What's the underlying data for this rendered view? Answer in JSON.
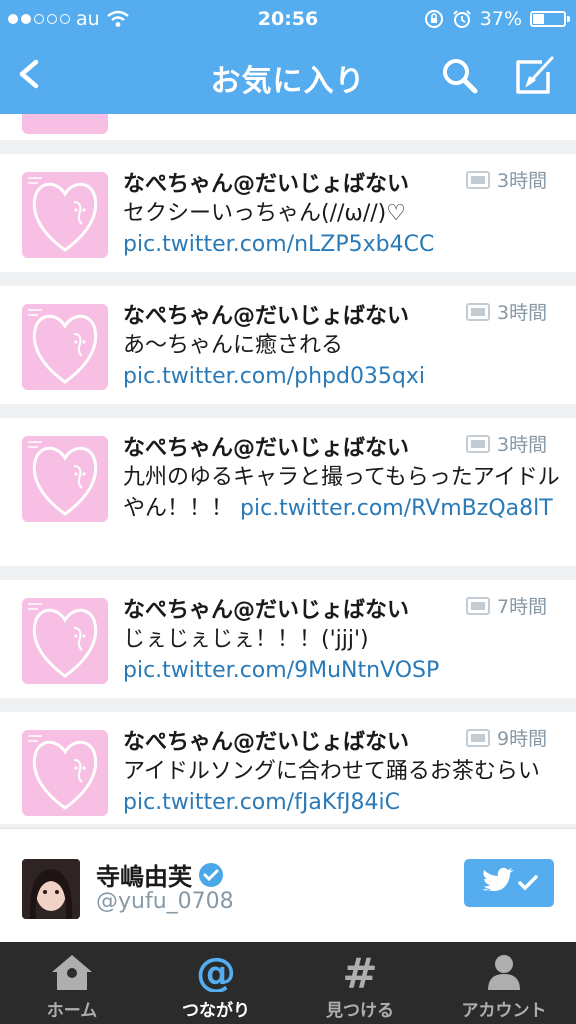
{
  "status": {
    "carrier": "au",
    "time": "20:56",
    "battery": "37%",
    "battery_level": 0.37
  },
  "nav": {
    "title": "お気に入り"
  },
  "tweets": [
    {
      "name": "なぺちゃん@だいじょばない",
      "time": "3時間",
      "text": "セクシーいっちゃん(//ω//)♡",
      "link": "pic.twitter.com/nLZP5xb4CC"
    },
    {
      "name": "なぺちゃん@だいじょばない",
      "time": "3時間",
      "text": "あ〜ちゃんに癒される",
      "link": "pic.twitter.com/phpd035qxi"
    },
    {
      "name": "なぺちゃん@だいじょばない",
      "time": "3時間",
      "text": "九州のゆるキャラと撮ってもらったアイドルやん！！！",
      "link": "pic.twitter.com/RVmBzQa8lT"
    },
    {
      "name": "なぺちゃん@だいじょばない",
      "time": "7時間",
      "text": "じぇじぇじぇ！！！('jjj')",
      "link": "pic.twitter.com/9MuNtnVOSP"
    },
    {
      "name": "なぺちゃん@だいじょばない",
      "time": "9時間",
      "text": "アイドルソングに合わせて踊るお茶むらい",
      "link": "pic.twitter.com/fJaKfJ84iC"
    }
  ],
  "profile": {
    "name": "寺嶋由芙",
    "handle": "@yufu_0708"
  },
  "tabs": [
    {
      "label": "ホーム",
      "icon": "home-icon"
    },
    {
      "label": "つながり",
      "icon": "at-icon"
    },
    {
      "label": "見つける",
      "icon": "hash-icon"
    },
    {
      "label": "アカウント",
      "icon": "person-icon"
    }
  ],
  "colors": {
    "brand": "#55acee",
    "link": "#2a7ab8",
    "tabbar": "#2b2b2b",
    "avatar": "#f7bfe3"
  }
}
